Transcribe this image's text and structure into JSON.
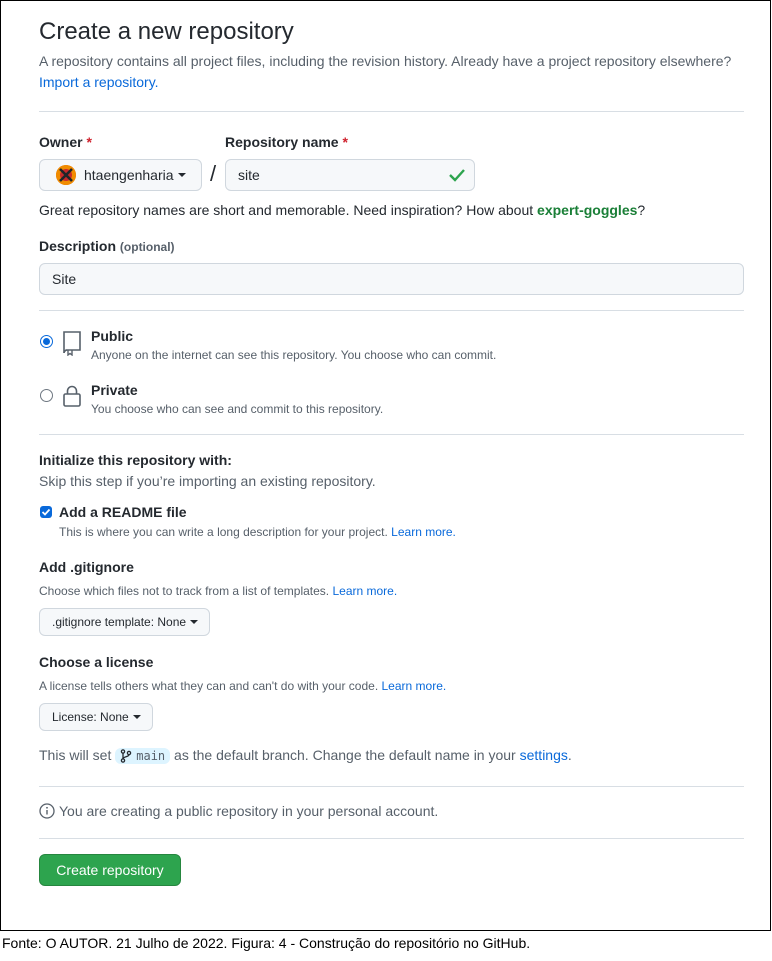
{
  "header": {
    "title": "Create a new repository",
    "subtitle": "A repository contains all project files, including the revision history. Already have a project repository elsewhere?",
    "import_link": "Import a repository."
  },
  "owner": {
    "label": "Owner",
    "required_mark": "*",
    "value": "htaengenharia"
  },
  "separator": "/",
  "repo_name": {
    "label": "Repository name",
    "required_mark": "*",
    "value": "site"
  },
  "suggestion": {
    "text": "Great repository names are short and memorable. Need inspiration? How about",
    "name": "expert-goggles",
    "end": "?"
  },
  "description": {
    "label": "Description",
    "optional": "(optional)",
    "value": "Site"
  },
  "visibility": {
    "public": {
      "title": "Public",
      "desc": "Anyone on the internet can see this repository. You choose who can commit.",
      "selected": true
    },
    "private": {
      "title": "Private",
      "desc": "You choose who can see and commit to this repository.",
      "selected": false
    }
  },
  "init": {
    "title": "Initialize this repository with:",
    "subtitle": "Skip this step if you’re importing an existing repository.",
    "readme": {
      "label": "Add a README file",
      "desc": "This is where you can write a long description for your project.",
      "learn_more": "Learn more.",
      "checked": true
    }
  },
  "gitignore": {
    "title": "Add .gitignore",
    "desc": "Choose which files not to track from a list of templates.",
    "learn_more": "Learn more.",
    "button": ".gitignore template: None"
  },
  "license": {
    "title": "Choose a license",
    "desc": "A license tells others what they can and can't do with your code.",
    "learn_more": "Learn more.",
    "button": "License: None"
  },
  "branch": {
    "prefix": "This will set",
    "name": "main",
    "middle": "as the default branch. Change the default name in your",
    "settings_link": "settings",
    "end": "."
  },
  "notice": "You are creating a public repository in your personal account.",
  "submit_label": "Create repository",
  "caption": "Fonte: O AUTOR. 21 Julho de 2022. Figura: 4 - Construção do repositório no GitHub.",
  "colors": {
    "link": "#0969da",
    "primary": "#2da44e",
    "success": "#1a7f37",
    "danger": "#cf222e"
  }
}
